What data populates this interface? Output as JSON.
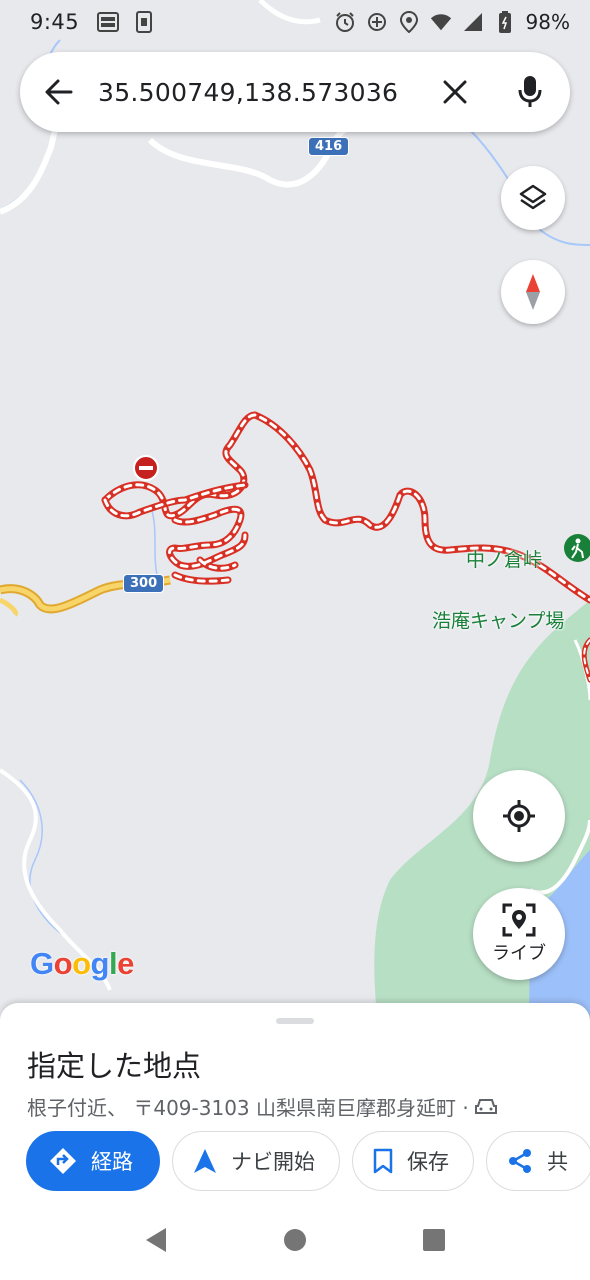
{
  "status_bar": {
    "time": "9:45",
    "battery": "98%",
    "icons": [
      "au-pay-icon",
      "screenshot-icon",
      "alarm-icon",
      "gps-plus-icon",
      "location-icon",
      "wifi-icon",
      "signal-icon",
      "battery-icon"
    ]
  },
  "search": {
    "query": "35.500749,138.573036",
    "back_icon": "arrow-back-icon",
    "clear_icon": "close-icon",
    "mic_icon": "mic-icon"
  },
  "map": {
    "labels": {
      "pass_name": "中ノ倉峠",
      "camp_name": "浩庵キャンプ場"
    },
    "road_shields": {
      "top": "416",
      "left": "300"
    },
    "logo": "Google",
    "live_button_label": "ライブ",
    "colors": {
      "route": "#d93025",
      "park": "#b7dfc4",
      "water": "#9cc0f9",
      "highway": "#f5c34d",
      "pin": "#c5221f"
    }
  },
  "sheet": {
    "title": "指定した地点",
    "address": "根子付近、 〒409-3103 山梨県南巨摩郡身延町 ·",
    "actions": {
      "route": "経路",
      "navigate": "ナビ開始",
      "save": "保存",
      "share": "共"
    },
    "accent": "#1a73e8"
  },
  "nav": {
    "back": "back-triangle-icon",
    "home": "home-circle-icon",
    "recents": "recents-square-icon"
  }
}
